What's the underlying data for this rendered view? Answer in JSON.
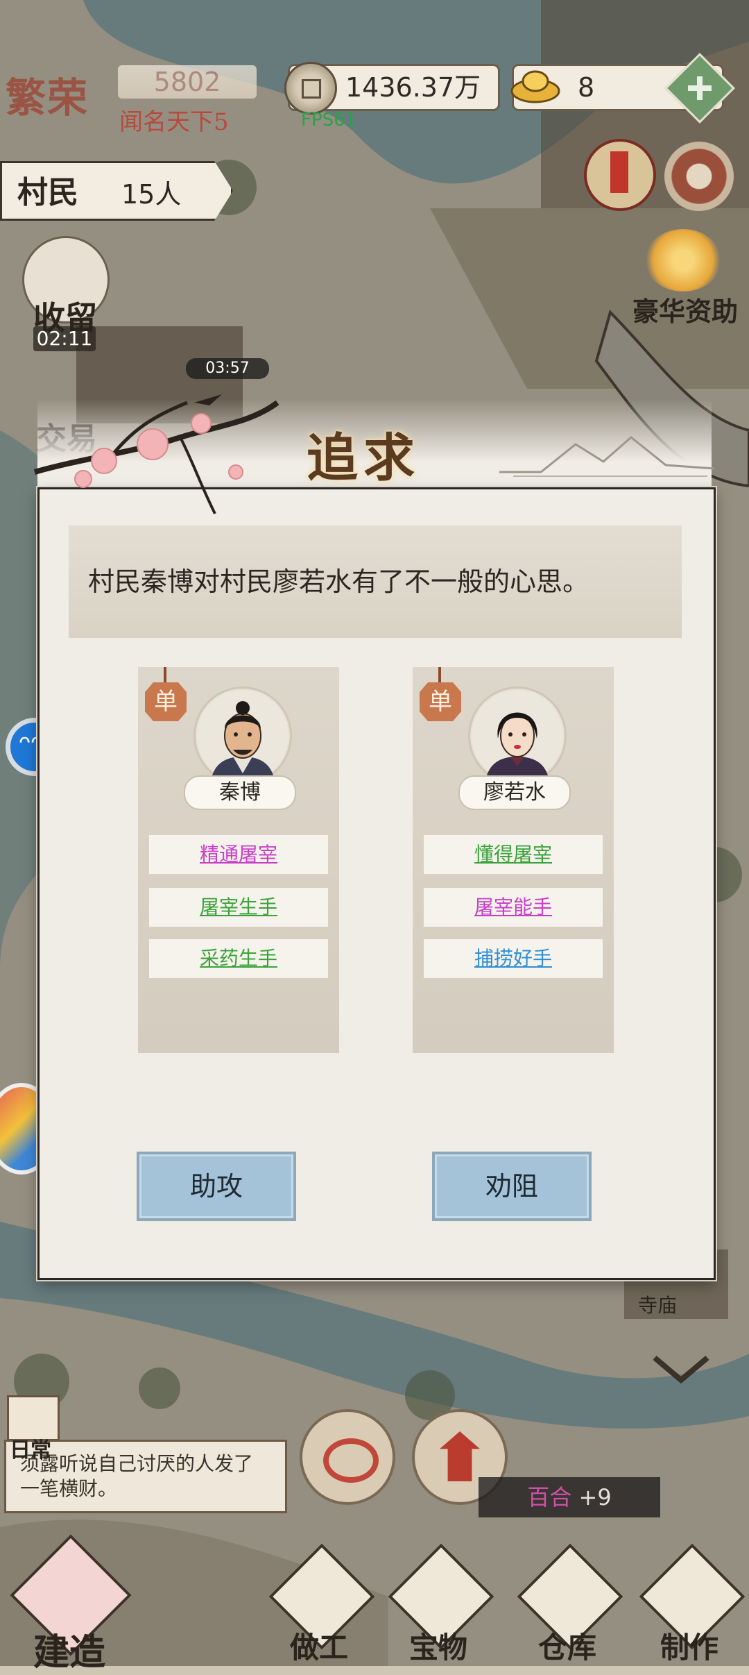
{
  "hud": {
    "prosperity_title": "繁荣",
    "prosperity_value": "5802",
    "prosperity_rank": "闻名天下5",
    "coins": "1436.37万",
    "gold": "8",
    "fps": "FPS61"
  },
  "villagers": {
    "label": "村民",
    "count": "15人"
  },
  "shelter": {
    "label": "收留",
    "timer": "02:11"
  },
  "map_timer": "03:57",
  "trade_label": "交易",
  "sponsor_label": "豪华资助",
  "modal": {
    "title": "追求",
    "message": "村民秦博对村民廖若水有了不一般的心思。",
    "left": {
      "tag": "单",
      "name": "秦博",
      "traits": [
        {
          "label": "精通屠宰",
          "color": "#c93fc9"
        },
        {
          "label": "屠宰生手",
          "color": "#3aa33a"
        },
        {
          "label": "采药生手",
          "color": "#3aa33a"
        }
      ]
    },
    "right": {
      "tag": "单",
      "name": "廖若水",
      "traits": [
        {
          "label": "懂得屠宰",
          "color": "#3aa33a"
        },
        {
          "label": "屠宰能手",
          "color": "#c93fc9"
        },
        {
          "label": "捕捞好手",
          "color": "#2f8fd6"
        }
      ]
    },
    "assist_label": "助攻",
    "dissuade_label": "劝阻"
  },
  "daily": {
    "label": "日常",
    "text": "须露听说自己讨厌的人发了一笔横财。"
  },
  "lily": {
    "label": "百合",
    "count": "+9"
  },
  "temple_label": "寺庙",
  "nav": {
    "build": "建造",
    "work": "做工",
    "treasure": "宝物",
    "storage": "仓库",
    "craft": "制作"
  }
}
